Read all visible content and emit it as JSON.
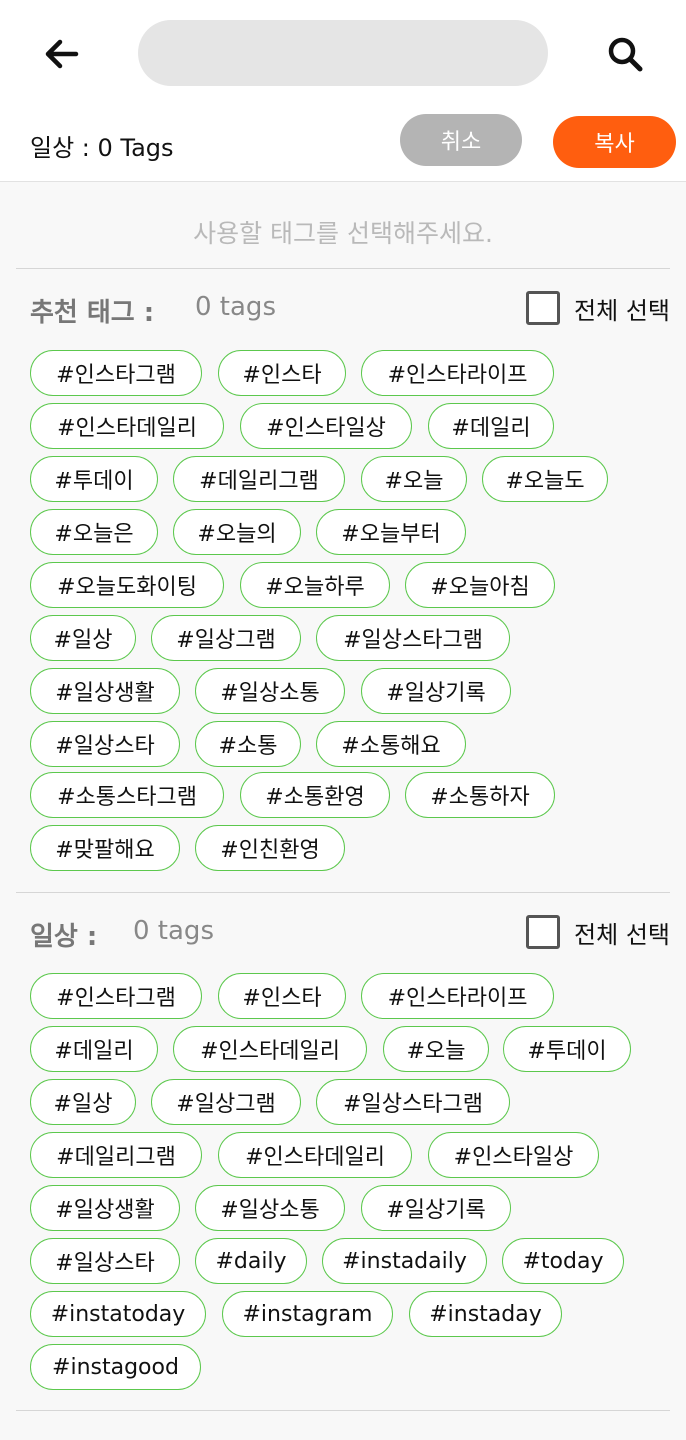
{
  "header": {
    "search_value": "",
    "count_label": "일상 : 0 Tags",
    "cancel_label": "취소",
    "copy_label": "복사"
  },
  "hint": "사용할 태그를 선택해주세요.",
  "sections": [
    {
      "title": "추천 태그 :",
      "count": "0 tags",
      "select_all_label": "전체 선택",
      "tag_rows": [
        [
          "#인스타그램",
          "#인스타",
          "#인스타라이프"
        ],
        [
          "#인스타데일리",
          "#인스타일상",
          "#데일리"
        ],
        [
          "#투데이",
          "#데일리그램",
          "#오늘",
          "#오늘도"
        ],
        [
          "#오늘은",
          "#오늘의",
          "#오늘부터"
        ],
        [
          "#오늘도화이팅",
          "#오늘하루",
          "#오늘아침"
        ],
        [
          "#일상",
          "#일상그램",
          "#일상스타그램"
        ],
        [
          "#일상생활",
          "#일상소통",
          "#일상기록"
        ],
        [
          "#일상스타",
          "#소통",
          "#소통해요"
        ],
        [
          "#소통스타그램",
          "#소통환영",
          "#소통하자"
        ],
        [
          "#맞팔해요",
          "#인친환영"
        ]
      ]
    },
    {
      "title": "일상 :",
      "count": "0 tags",
      "select_all_label": "전체 선택",
      "tag_rows": [
        [
          "#인스타그램",
          "#인스타",
          "#인스타라이프"
        ],
        [
          "#데일리",
          "#인스타데일리",
          "#오늘",
          "#투데이"
        ],
        [
          "#일상",
          "#일상그램",
          "#일상스타그램"
        ],
        [
          "#데일리그램",
          "#인스타데일리",
          "#인스타일상"
        ],
        [
          "#일상생활",
          "#일상소통",
          "#일상기록"
        ],
        [
          "#일상스타",
          "#daily",
          "#instadaily",
          "#today"
        ],
        [
          "#instatoday",
          "#instagram",
          "#instaday"
        ],
        [
          "#instagood"
        ]
      ]
    }
  ]
}
